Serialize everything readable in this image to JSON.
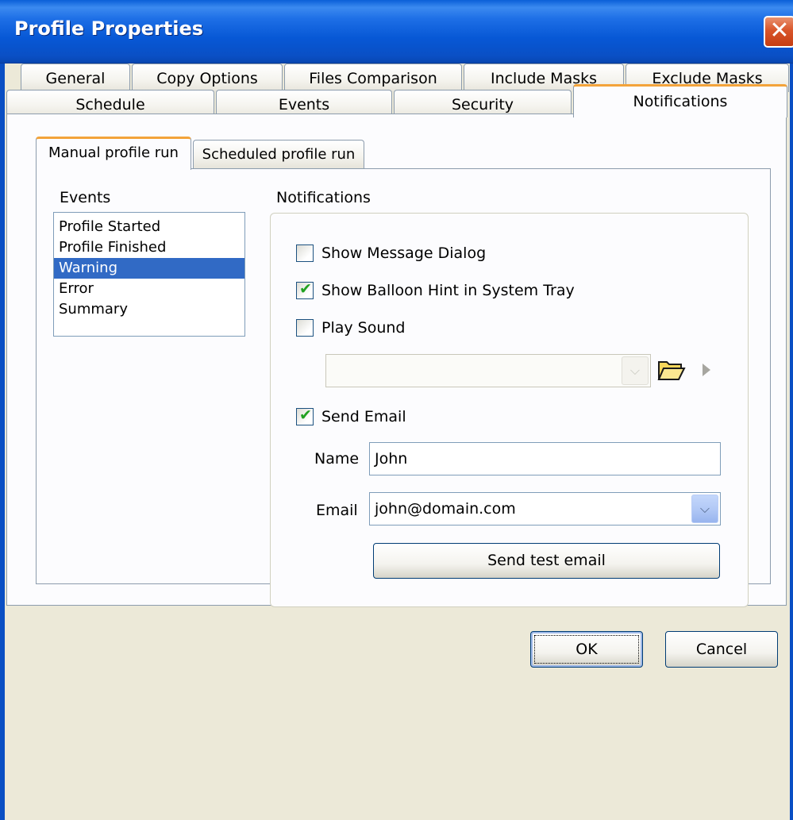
{
  "window": {
    "title": "Profile Properties",
    "close_glyph": "✕"
  },
  "outer_tabs_row1": [
    "General",
    "Copy Options",
    "Files Comparison",
    "Include Masks",
    "Exclude Masks"
  ],
  "outer_tabs_row2": [
    "Schedule",
    "Events",
    "Security",
    "Notifications"
  ],
  "active_outer_tab": "Notifications",
  "inner_tabs": [
    "Manual profile run",
    "Scheduled profile run"
  ],
  "active_inner_tab": "Manual profile run",
  "events": {
    "label": "Events",
    "items": [
      "Profile Started",
      "Profile Finished",
      "Warning",
      "Error",
      "Summary"
    ],
    "selected": "Warning"
  },
  "notifications": {
    "label": "Notifications",
    "show_message_dialog": {
      "label": "Show Message Dialog",
      "checked": false
    },
    "show_balloon_hint": {
      "label": "Show Balloon Hint in System Tray",
      "checked": true
    },
    "play_sound": {
      "label": "Play Sound",
      "checked": false,
      "sound_value": ""
    },
    "send_email": {
      "label": "Send Email",
      "checked": true
    },
    "name": {
      "label": "Name",
      "value": "John"
    },
    "email": {
      "label": "Email",
      "value": "john@domain.com"
    },
    "send_test_label": "Send test email"
  },
  "buttons": {
    "ok": "OK",
    "cancel": "Cancel"
  },
  "icons": {
    "folder": "folder-open-icon",
    "play": "play-icon",
    "checkmark": "checkmark-icon",
    "dropdown": "chevron-down-icon"
  },
  "colors": {
    "titlebar": "#0a5fd8",
    "active_tab_accent": "#f3a33a",
    "selection": "#316ac5",
    "check": "#21a121"
  }
}
